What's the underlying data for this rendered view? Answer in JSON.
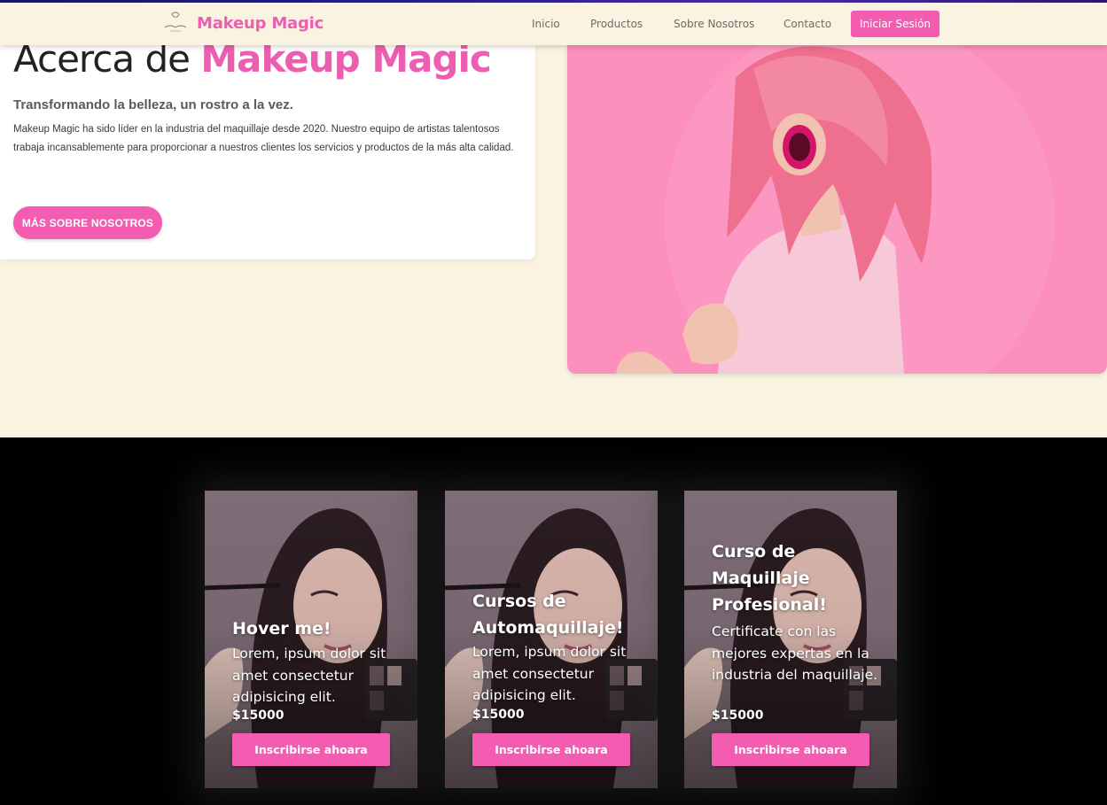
{
  "colors": {
    "accent": "#f45cb2",
    "brand": "#ec5fb0",
    "cream": "#faf3e1",
    "dark_section": "#000000"
  },
  "navbar": {
    "brand_name": "Makeup Magic",
    "links": [
      "Inicio",
      "Productos",
      "Sobre Nosotros",
      "Contacto"
    ],
    "login_label": "Iniciar Sesión"
  },
  "about": {
    "title_prefix": "Acerca de ",
    "title_highlight": "Makeup Magic",
    "subtitle": "Transformando la belleza, un rostro a la vez.",
    "text": "Makeup Magic ha sido líder en la industria del maquillaje desde 2020. Nuestro equipo de artistas talentosos trabaja incansablemente para proporcionar a nuestros clientes los servicios y productos de la más alta calidad.",
    "button_label": "MÁS SOBRE NOSOTROS"
  },
  "cards": [
    {
      "title": "Hover me!",
      "description": "Lorem, ipsum dolor sit amet consectetur adipisicing elit.",
      "price": "$15000",
      "button_label": "Inscribirse ahoara"
    },
    {
      "title": "Cursos de Automaquillaje!",
      "description": "Lorem, ipsum dolor sit amet consectetur adipisicing elit.",
      "price": "$15000",
      "button_label": "Inscribirse ahoara"
    },
    {
      "title": "Curso de Maquillaje Profesional!",
      "description": "Certificate con las mejores expertas en la industria del maquillaje.",
      "price": "$15000",
      "button_label": "Inscribirse ahoara"
    }
  ]
}
